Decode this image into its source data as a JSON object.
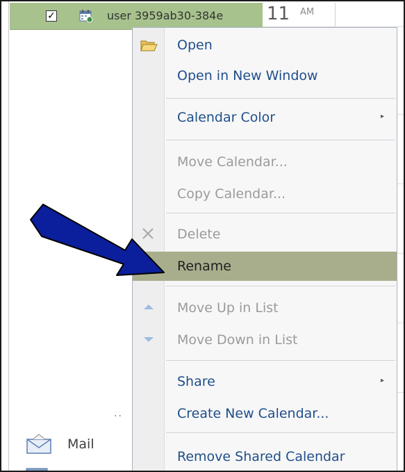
{
  "calendar_row": {
    "checked": true,
    "checkbox_mark": "✓",
    "label": "user 3959ab30-384e"
  },
  "time_column": {
    "hour": "11",
    "ampm": "AM"
  },
  "context_menu": {
    "items": [
      {
        "label": "Open",
        "icon": "open-folder-icon",
        "disabled": false,
        "submenu": false
      },
      {
        "label": "Open in New Window",
        "icon": "",
        "disabled": false,
        "submenu": false
      },
      {
        "label": "Calendar Color",
        "icon": "",
        "disabled": false,
        "submenu": true
      },
      {
        "label": "Move Calendar...",
        "icon": "",
        "disabled": true,
        "submenu": false
      },
      {
        "label": "Copy Calendar...",
        "icon": "",
        "disabled": true,
        "submenu": false
      },
      {
        "label": "Delete",
        "icon": "delete-x-icon",
        "disabled": true,
        "submenu": false
      },
      {
        "label": "Rename",
        "icon": "",
        "disabled": false,
        "submenu": false,
        "highlighted": true
      },
      {
        "label": "Move Up in List",
        "icon": "move-up-icon",
        "disabled": true,
        "submenu": false
      },
      {
        "label": "Move Down in List",
        "icon": "move-down-icon",
        "disabled": true,
        "submenu": false
      },
      {
        "label": "Share",
        "icon": "",
        "disabled": false,
        "submenu": true
      },
      {
        "label": "Create New Calendar...",
        "icon": "",
        "disabled": false,
        "submenu": false
      },
      {
        "label": "Remove Shared Calendar",
        "icon": "",
        "disabled": false,
        "submenu": false
      }
    ],
    "submenu_arrow": "▸"
  },
  "navigation": {
    "mail_label": "Mail",
    "overflow_dots": "··"
  },
  "colors": {
    "selected_row": "#a7c28d",
    "highlight": "#a8ad8c",
    "menu_text": "#1f4e8b",
    "disabled_text": "#9b9b9b",
    "annotation_arrow": "#0b1f9c"
  }
}
